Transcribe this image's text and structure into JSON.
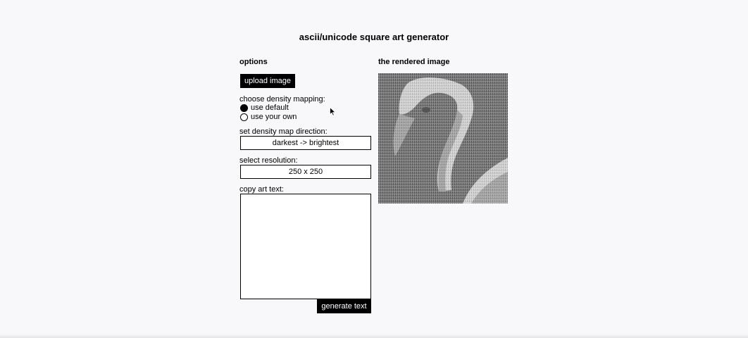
{
  "title": "ascii/unicode square art generator",
  "options": {
    "heading": "options",
    "upload_label": "upload image",
    "density_mapping": {
      "label": "choose density mapping:",
      "options": [
        {
          "label": "use default",
          "checked": true
        },
        {
          "label": "use your own",
          "checked": false
        }
      ]
    },
    "direction": {
      "label": "set density map direction:",
      "value": "darkest -> brightest"
    },
    "resolution": {
      "label": "select resolution:",
      "value": "250 x 250"
    },
    "copy_text": {
      "label": "copy art text:",
      "value": ""
    },
    "generate_label": "generate text"
  },
  "rendered": {
    "heading": "the rendered image",
    "subject": "swan"
  },
  "colors": {
    "background": "#f8f7f9",
    "button": "#000000",
    "button_text": "#ffffff"
  }
}
